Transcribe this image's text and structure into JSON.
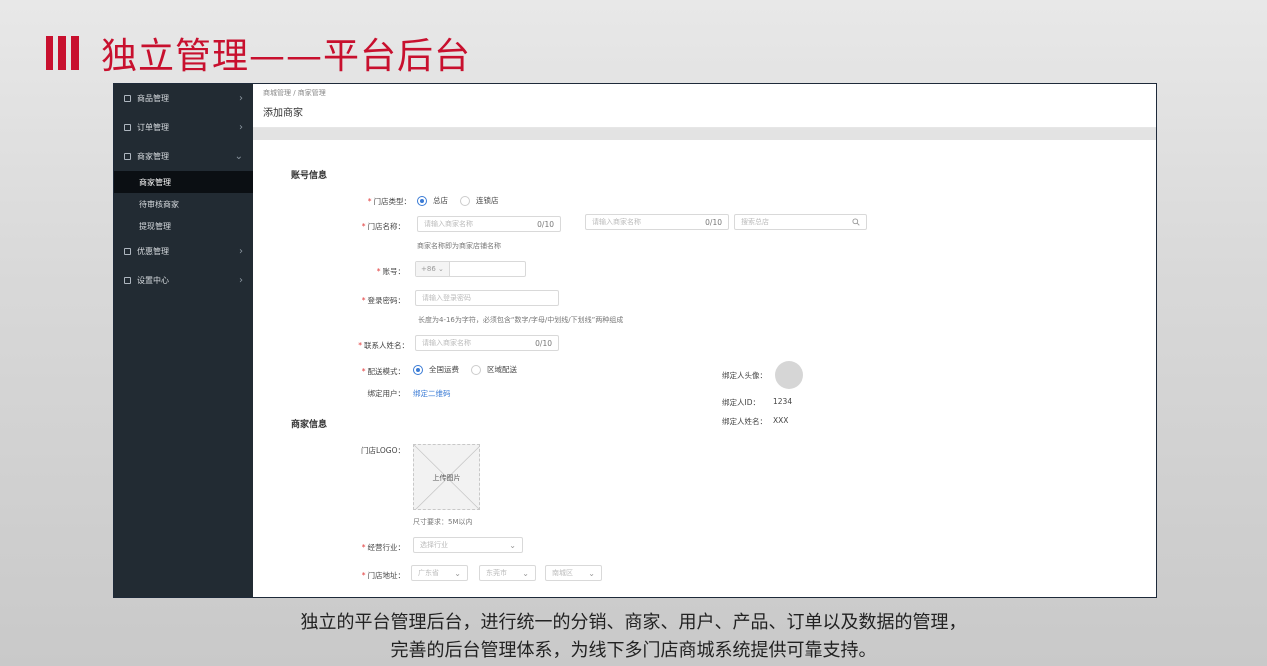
{
  "slide": {
    "title": "独立管理——平台后台",
    "caption_line1": "独立的平台管理后台，进行统一的分销、商家、用户、产品、订单以及数据的管理，",
    "caption_line2": "完善的后台管理体系，为线下多门店商城系统提供可靠支持。"
  },
  "sidebar": {
    "items": [
      {
        "label": "商品管理",
        "icon": "edit-icon",
        "chevron": "›"
      },
      {
        "label": "订单管理",
        "icon": "edit-icon",
        "chevron": "›"
      },
      {
        "label": "商家管理",
        "icon": "list-icon",
        "chevron": "⌄"
      },
      {
        "label": "优惠管理",
        "icon": "edit-icon",
        "chevron": "›"
      },
      {
        "label": "设置中心",
        "icon": "edit-icon",
        "chevron": "›"
      }
    ],
    "sub_items": [
      {
        "label": "商家管理",
        "active": true
      },
      {
        "label": "待审核商家",
        "active": false
      },
      {
        "label": "提现管理",
        "active": false
      }
    ]
  },
  "header": {
    "breadcrumb": "商城管理 / 商家管理",
    "page_title": "添加商家"
  },
  "form": {
    "account_section": "账号信息",
    "store_type_label": "门店类型：",
    "store_type_options": [
      "总店",
      "连锁店"
    ],
    "store_type_selected": "总店",
    "store_name_label": "门店名称：",
    "store_name_placeholder": "请输入商家名称",
    "store_name_count": "0/10",
    "store_name2_placeholder": "请输入商家名称",
    "store_name2_count": "0/10",
    "search_store_placeholder": "搜索总店",
    "store_name_hint": "商家名称即为商家店铺名称",
    "account_label": "账号：",
    "phone_prefix": "+86",
    "password_label": "登录密码：",
    "password_placeholder": "请输入登录密码",
    "password_hint": "长度为4-16为字符，必须包含“数字/字母/中划线/下划线”两种组成",
    "contact_label": "联系人姓名：",
    "contact_placeholder": "请输入商家名称",
    "contact_count": "0/10",
    "delivery_label": "配送模式：",
    "delivery_options": [
      "全国运费",
      "区域配送"
    ],
    "delivery_selected": "全国运费",
    "bind_user_label": "绑定用户：",
    "bind_user_link": "绑定二维码",
    "binder_avatar_label": "绑定人头像：",
    "binder_id_label": "绑定人ID：",
    "binder_id_value": "1234",
    "binder_name_label": "绑定人姓名：",
    "binder_name_value": "XXX",
    "merchant_section": "商家信息",
    "logo_label": "门店LOGO：",
    "upload_label": "上传图片",
    "logo_hint": "尺寸要求：5M以内",
    "industry_label": "经营行业：",
    "industry_placeholder": "选择行业",
    "address_label": "门店地址：",
    "province": "广东省",
    "city": "东莞市",
    "district": "南城区"
  },
  "colors": {
    "title_red": "#c8102e",
    "sidebar_bg": "#222b33",
    "accent_blue": "#3a7bd5",
    "required_red": "#e23b3b"
  }
}
